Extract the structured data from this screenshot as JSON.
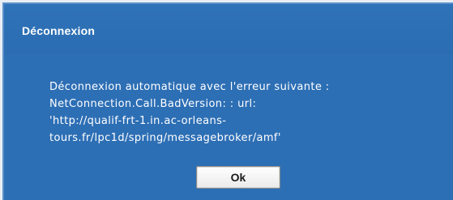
{
  "dialog": {
    "title": "Déconnexion",
    "message_lines": [
      "Déconnexion automatique avec l'erreur suivante :",
      "NetConnection.Call.BadVersion: : url:",
      "'http://qualif-frt-1.in.ac-orleans-",
      "tours.fr/lpc1d/spring/messagebroker/amf'"
    ],
    "ok_label": "Ok"
  },
  "colors": {
    "dialog_background": "#2d6fb5",
    "text": "#ffffff",
    "button_background": "#ffffff"
  }
}
